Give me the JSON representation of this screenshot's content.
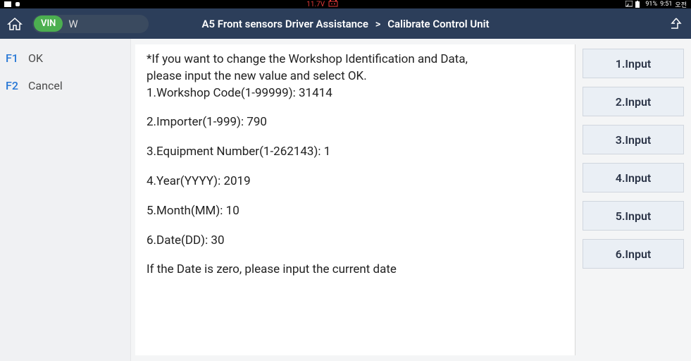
{
  "status": {
    "voltage": "11.7V",
    "battery": "91%",
    "time": "9:51",
    "ampm": "오전"
  },
  "header": {
    "vin_badge": "VIN",
    "vin_value": "W",
    "breadcrumb_context": "A5 Front sensors Driver Assistance",
    "breadcrumb_sep": ">",
    "breadcrumb_current": "Calibrate Control Unit"
  },
  "fkeys": [
    {
      "code": "F1",
      "label": "OK"
    },
    {
      "code": "F2",
      "label": "Cancel"
    }
  ],
  "content": {
    "lines": [
      "*If you want to change the Workshop Identification and Data,",
      "please input the new value and select OK.",
      "1.Workshop Code(1-99999): 31414",
      "",
      "2.Importer(1-999): 790",
      "",
      "3.Equipment Number(1-262143): 1",
      "",
      "4.Year(YYYY): 2019",
      "",
      "5.Month(MM): 10",
      "",
      "6.Date(DD): 30",
      "",
      "If the Date is zero, please input the current date"
    ]
  },
  "inputs": [
    "1.Input",
    "2.Input",
    "3.Input",
    "4.Input",
    "5.Input",
    "6.Input"
  ]
}
